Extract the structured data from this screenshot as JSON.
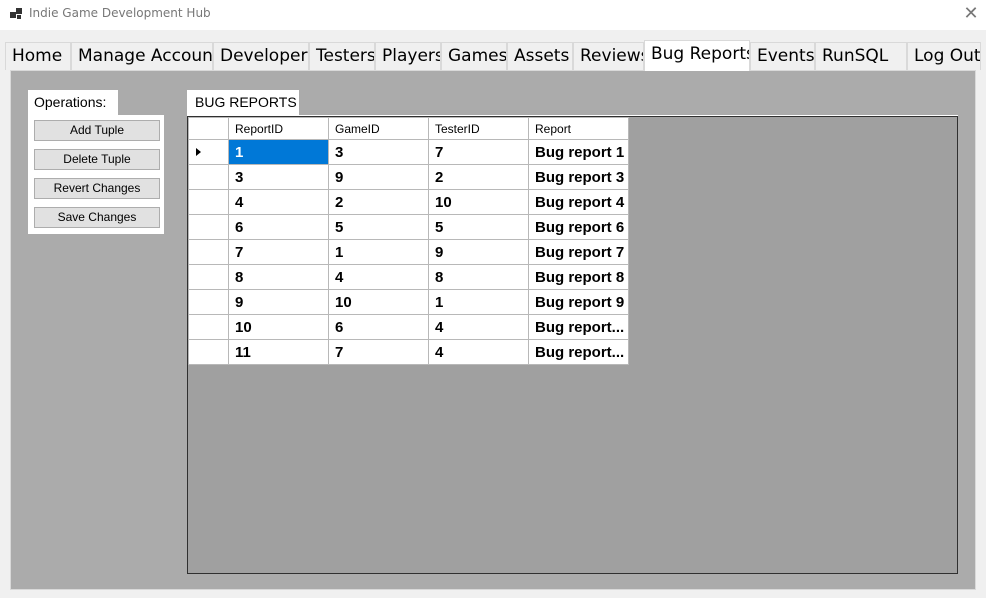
{
  "window": {
    "title": "Indie Game Development Hub",
    "close_glyph": "✕"
  },
  "tabs": [
    {
      "label": "Home"
    },
    {
      "label": "Manage Account"
    },
    {
      "label": "Developers"
    },
    {
      "label": "Testers"
    },
    {
      "label": "Players"
    },
    {
      "label": "Games"
    },
    {
      "label": "Assets"
    },
    {
      "label": "Reviews"
    },
    {
      "label": "Bug Reports",
      "active": true
    },
    {
      "label": "Events"
    },
    {
      "label": "RunSQL"
    },
    {
      "label": "Log Out"
    }
  ],
  "operations": {
    "title": "Operations:",
    "buttons": {
      "add": "Add Tuple",
      "delete": "Delete Tuple",
      "revert": "Revert Changes",
      "save": "Save Changes"
    }
  },
  "bug_reports": {
    "title": "BUG REPORTS",
    "columns": [
      "ReportID",
      "GameID",
      "TesterID",
      "Report"
    ],
    "rows": [
      [
        "1",
        "3",
        "7",
        "Bug report 1"
      ],
      [
        "3",
        "9",
        "2",
        "Bug report 3"
      ],
      [
        "4",
        "2",
        "10",
        "Bug report 4"
      ],
      [
        "6",
        "5",
        "5",
        "Bug report 6"
      ],
      [
        "7",
        "1",
        "9",
        "Bug report 7"
      ],
      [
        "8",
        "4",
        "8",
        "Bug report 8"
      ],
      [
        "9",
        "10",
        "1",
        "Bug report 9"
      ],
      [
        "10",
        "6",
        "4",
        "Bug report..."
      ],
      [
        "11",
        "7",
        "4",
        "Bug report..."
      ]
    ],
    "selected_cell": "1"
  },
  "colors": {
    "selection": "#0078d7",
    "tab_page_bg": "#ababab",
    "grid_bg": "#a0a0a0"
  }
}
